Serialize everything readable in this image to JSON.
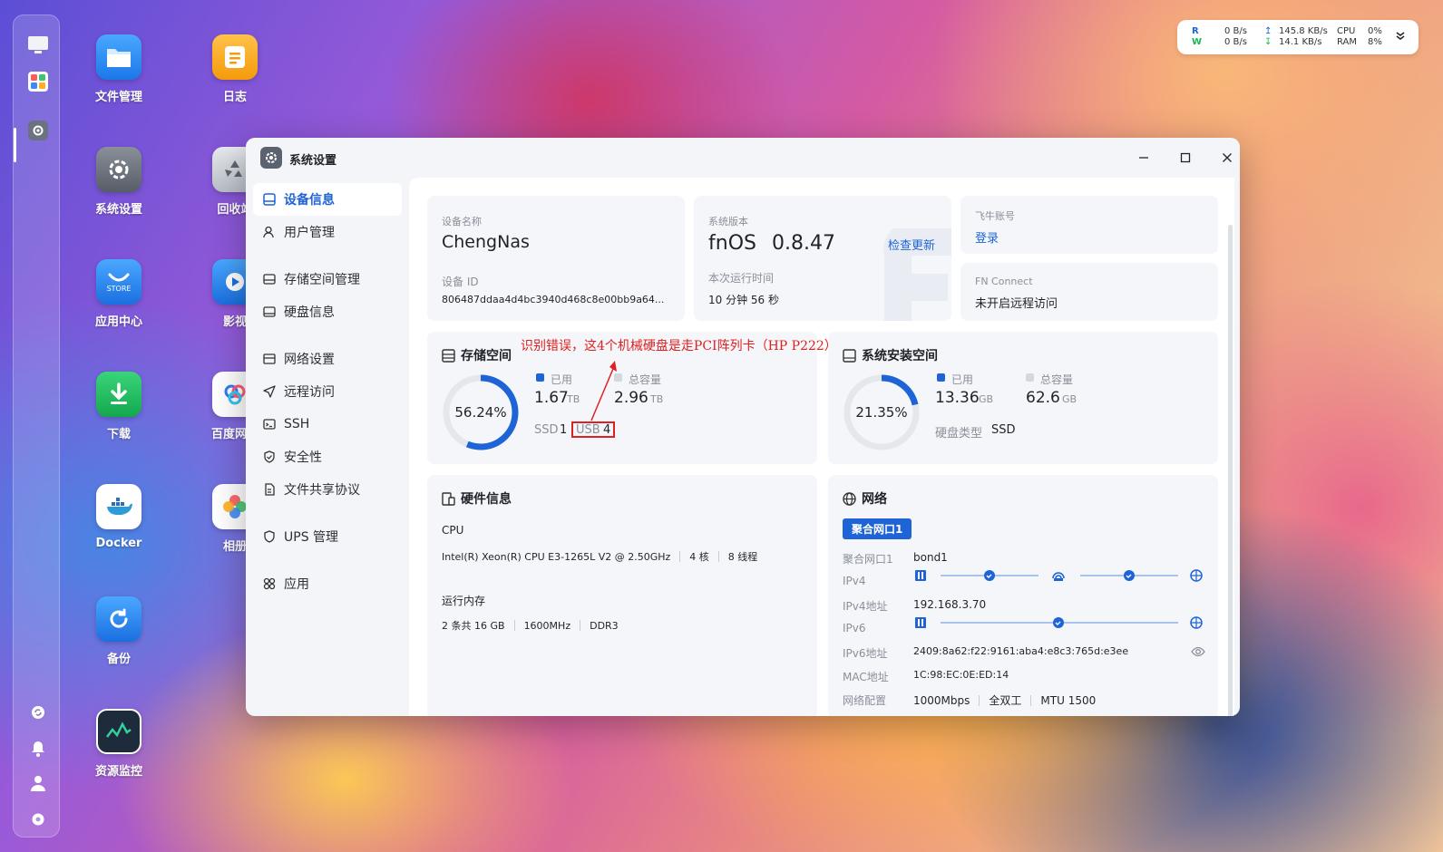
{
  "desktop": {
    "icons": [
      {
        "label": "文件管理",
        "icon": "folder-icon",
        "color": "#2a8cf0"
      },
      {
        "label": "日志",
        "icon": "log-icon",
        "color": "#f7a21b"
      },
      {
        "label": "系统设置",
        "icon": "gear-icon",
        "color": "#6b7280"
      },
      {
        "label": "回收站",
        "icon": "recycle-icon",
        "color": "#9aa1aa"
      },
      {
        "label": "应用中心",
        "icon": "store-icon",
        "color": "#2a8cf0"
      },
      {
        "label": "影视",
        "icon": "video-icon",
        "color": "#2a8cf0"
      },
      {
        "label": "下载",
        "icon": "download-icon",
        "color": "#1db45a"
      },
      {
        "label": "百度网盘",
        "icon": "baidu-icon",
        "color": "#ffffff"
      },
      {
        "label": "Docker",
        "icon": "docker-icon",
        "color": "#ffffff"
      },
      {
        "label": "相册",
        "icon": "photos-icon",
        "color": "#ffffff"
      },
      {
        "label": "备份",
        "icon": "backup-icon",
        "color": "#2a8cf0"
      },
      {
        "label": "资源监控",
        "icon": "monitor-icon",
        "color": "#1d2b3a"
      }
    ],
    "store_badge": "STORE"
  },
  "monitor": {
    "r_label": "R",
    "w_label": "W",
    "r_rate": "0  B/s",
    "w_rate": "0  B/s",
    "up_rate": "145.8 KB/s",
    "down_rate": "14.1 KB/s",
    "cpu_label": "CPU",
    "ram_label": "RAM",
    "cpu_value": "0%",
    "ram_value": "8%"
  },
  "window": {
    "title": "系统设置",
    "sidebar": [
      {
        "label": "设备信息",
        "icon": "device-icon",
        "active": true
      },
      {
        "label": "用户管理",
        "icon": "user-icon"
      },
      {
        "label": "存储空间管理",
        "icon": "storage-icon"
      },
      {
        "label": "硬盘信息",
        "icon": "disk-icon"
      },
      {
        "label": "网络设置",
        "icon": "network-icon"
      },
      {
        "label": "远程访问",
        "icon": "remote-icon"
      },
      {
        "label": "SSH",
        "icon": "ssh-icon"
      },
      {
        "label": "安全性",
        "icon": "shield-icon"
      },
      {
        "label": "文件共享协议",
        "icon": "file-share-icon"
      },
      {
        "label": "UPS 管理",
        "icon": "ups-icon"
      },
      {
        "label": "应用",
        "icon": "apps-icon"
      }
    ],
    "device": {
      "name_label": "设备名称",
      "name": "ChengNas",
      "id_label": "设备 ID",
      "id": "806487ddaa4d4bc3940d468c8e00bb9a64..."
    },
    "system": {
      "version_label": "系统版本",
      "os": "fnOS",
      "version": "0.8.47",
      "check_update": "检查更新",
      "uptime_label": "本次运行时间",
      "uptime": "10 分钟 56 秒"
    },
    "account": {
      "label": "飞牛账号",
      "login": "登录"
    },
    "fn_connect": {
      "label": "FN Connect",
      "value": "未开启远程访问"
    },
    "storage": {
      "title": "存储空间",
      "percent_text": "56.24%",
      "percent": 56.24,
      "used_label": "已用",
      "used_value": "1.67",
      "used_unit": "TB",
      "total_label": "总容量",
      "total_value": "2.96",
      "total_unit": "TB",
      "ssd_label": "SSD",
      "ssd_count": "1",
      "usb_label": "USB",
      "usb_count": "4"
    },
    "sys_install": {
      "title": "系统安装空间",
      "percent_text": "21.35%",
      "percent": 21.35,
      "used_label": "已用",
      "used_value": "13.36",
      "used_unit": "GB",
      "total_label": "总容量",
      "total_value": "62.6",
      "total_unit": "GB",
      "disk_type_label": "硬盘类型",
      "disk_type": "SSD"
    },
    "hardware": {
      "title": "硬件信息",
      "cpu_label": "CPU",
      "cpu_model": "Intel(R) Xeon(R) CPU E3-1265L V2 @ 2.50GHz",
      "cpu_cores": "4 核",
      "cpu_threads": "8 线程",
      "mem_label": "运行内存",
      "mem_size": "2 条共 16 GB",
      "mem_speed": "1600MHz",
      "mem_type": "DDR3"
    },
    "network": {
      "title": "网络",
      "tab": "聚合网口1",
      "rows": [
        {
          "label": "聚合网口1",
          "value": "bond1"
        },
        {
          "label": "IPv4",
          "value": ""
        },
        {
          "label": "IPv4地址",
          "value": "192.168.3.70"
        },
        {
          "label": "IPv6",
          "value": ""
        },
        {
          "label": "IPv6地址",
          "value": "2409:8a62:f22:9161:aba4:e8c3:765d:e3ee"
        },
        {
          "label": "MAC地址",
          "value": "1C:98:EC:0E:ED:14"
        },
        {
          "label": "网络配置",
          "value": "1000Mbps"
        }
      ],
      "duplex": "全双工",
      "mtu": "MTU 1500"
    }
  },
  "annotation": {
    "text": "识别错误，这4个机械硬盘是走PCI阵列卡（HP P222）",
    "color": "#e02020"
  },
  "colors": {
    "accent": "#1e64d6",
    "ring_track": "#e4e7ec"
  }
}
